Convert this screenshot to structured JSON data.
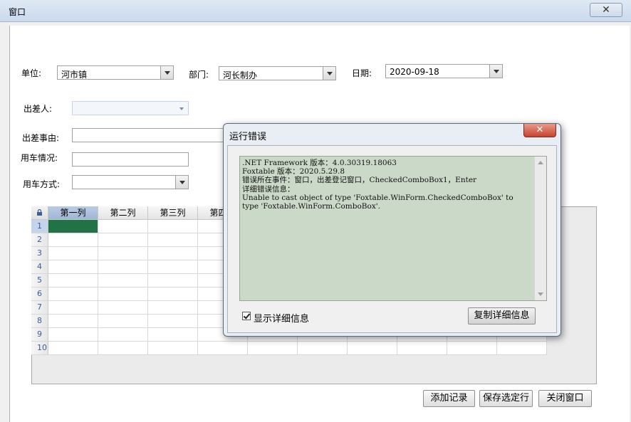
{
  "window": {
    "title": "窗口",
    "close_glyph": "✕"
  },
  "form": {
    "unit_label": "单位:",
    "unit_value": "河市镇",
    "dept_label": "部门:",
    "dept_value": "河长制办",
    "date_label": "日期:",
    "date_value": "2020-09-18",
    "traveler_label": "出差人:",
    "traveler_value": "",
    "reason_label": "出差事由:",
    "reason_value": "",
    "car_info_label": "用车情况:",
    "car_info_value": "",
    "car_mode_label": "用车方式:",
    "car_mode_value": ""
  },
  "grid": {
    "columns": [
      "第一列",
      "第二列",
      "第三列",
      "第四列"
    ],
    "rows": [
      "1",
      "2",
      "3",
      "4",
      "5",
      "6",
      "7",
      "8",
      "9",
      "10"
    ]
  },
  "buttons": {
    "add": "添加记录",
    "save": "保存选定行",
    "close": "关闭窗口"
  },
  "dialog": {
    "title": "运行错误",
    "close_glyph": "✕",
    "message": ".NET Framework 版本：4.0.30319.18063\nFoxtable 版本：2020.5.29.8\n错误所在事件：窗口，出差登记窗口，CheckedComboBox1，Enter\n详细错误信息：\nUnable to cast object of type 'Foxtable.WinForm.CheckedComboBox' to type 'Foxtable.WinForm.ComboBox'.",
    "checkbox_label": "显示详细信息",
    "copy_button": "复制详细信息"
  },
  "colors": {
    "selected_cell": "#217346",
    "error_box_bg": "#cbdac8",
    "dialog_close": "#c7432e"
  }
}
